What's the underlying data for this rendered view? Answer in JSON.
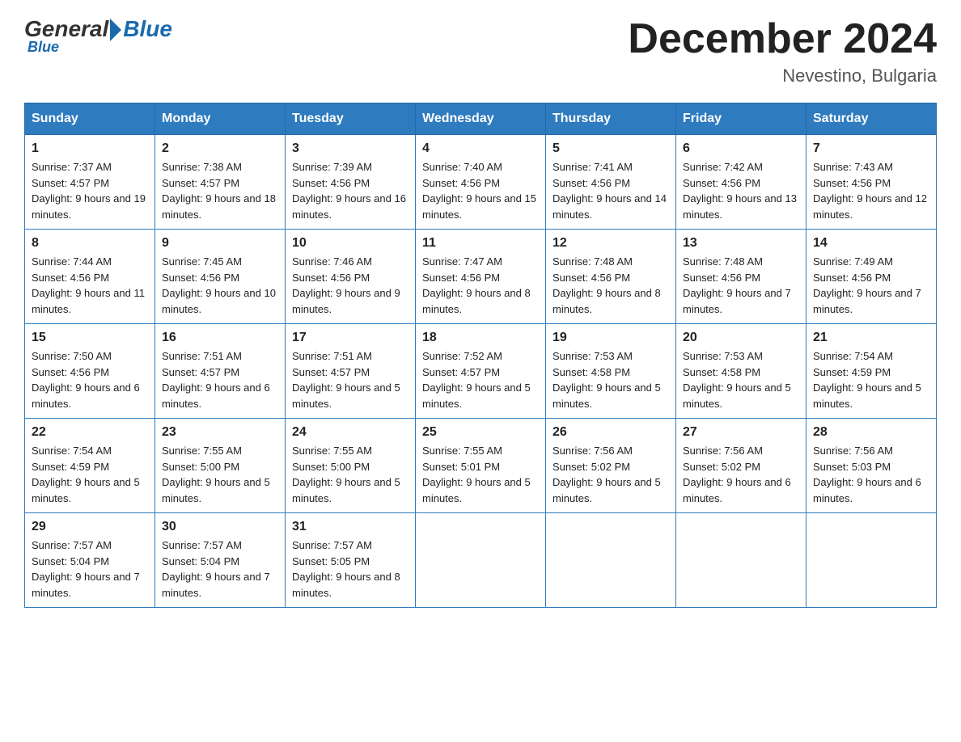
{
  "header": {
    "logo_general": "General",
    "logo_blue": "Blue",
    "title": "December 2024",
    "subtitle": "Nevestino, Bulgaria"
  },
  "weekdays": [
    "Sunday",
    "Monday",
    "Tuesday",
    "Wednesday",
    "Thursday",
    "Friday",
    "Saturday"
  ],
  "weeks": [
    [
      {
        "day": "1",
        "sunrise": "Sunrise: 7:37 AM",
        "sunset": "Sunset: 4:57 PM",
        "daylight": "Daylight: 9 hours and 19 minutes."
      },
      {
        "day": "2",
        "sunrise": "Sunrise: 7:38 AM",
        "sunset": "Sunset: 4:57 PM",
        "daylight": "Daylight: 9 hours and 18 minutes."
      },
      {
        "day": "3",
        "sunrise": "Sunrise: 7:39 AM",
        "sunset": "Sunset: 4:56 PM",
        "daylight": "Daylight: 9 hours and 16 minutes."
      },
      {
        "day": "4",
        "sunrise": "Sunrise: 7:40 AM",
        "sunset": "Sunset: 4:56 PM",
        "daylight": "Daylight: 9 hours and 15 minutes."
      },
      {
        "day": "5",
        "sunrise": "Sunrise: 7:41 AM",
        "sunset": "Sunset: 4:56 PM",
        "daylight": "Daylight: 9 hours and 14 minutes."
      },
      {
        "day": "6",
        "sunrise": "Sunrise: 7:42 AM",
        "sunset": "Sunset: 4:56 PM",
        "daylight": "Daylight: 9 hours and 13 minutes."
      },
      {
        "day": "7",
        "sunrise": "Sunrise: 7:43 AM",
        "sunset": "Sunset: 4:56 PM",
        "daylight": "Daylight: 9 hours and 12 minutes."
      }
    ],
    [
      {
        "day": "8",
        "sunrise": "Sunrise: 7:44 AM",
        "sunset": "Sunset: 4:56 PM",
        "daylight": "Daylight: 9 hours and 11 minutes."
      },
      {
        "day": "9",
        "sunrise": "Sunrise: 7:45 AM",
        "sunset": "Sunset: 4:56 PM",
        "daylight": "Daylight: 9 hours and 10 minutes."
      },
      {
        "day": "10",
        "sunrise": "Sunrise: 7:46 AM",
        "sunset": "Sunset: 4:56 PM",
        "daylight": "Daylight: 9 hours and 9 minutes."
      },
      {
        "day": "11",
        "sunrise": "Sunrise: 7:47 AM",
        "sunset": "Sunset: 4:56 PM",
        "daylight": "Daylight: 9 hours and 8 minutes."
      },
      {
        "day": "12",
        "sunrise": "Sunrise: 7:48 AM",
        "sunset": "Sunset: 4:56 PM",
        "daylight": "Daylight: 9 hours and 8 minutes."
      },
      {
        "day": "13",
        "sunrise": "Sunrise: 7:48 AM",
        "sunset": "Sunset: 4:56 PM",
        "daylight": "Daylight: 9 hours and 7 minutes."
      },
      {
        "day": "14",
        "sunrise": "Sunrise: 7:49 AM",
        "sunset": "Sunset: 4:56 PM",
        "daylight": "Daylight: 9 hours and 7 minutes."
      }
    ],
    [
      {
        "day": "15",
        "sunrise": "Sunrise: 7:50 AM",
        "sunset": "Sunset: 4:56 PM",
        "daylight": "Daylight: 9 hours and 6 minutes."
      },
      {
        "day": "16",
        "sunrise": "Sunrise: 7:51 AM",
        "sunset": "Sunset: 4:57 PM",
        "daylight": "Daylight: 9 hours and 6 minutes."
      },
      {
        "day": "17",
        "sunrise": "Sunrise: 7:51 AM",
        "sunset": "Sunset: 4:57 PM",
        "daylight": "Daylight: 9 hours and 5 minutes."
      },
      {
        "day": "18",
        "sunrise": "Sunrise: 7:52 AM",
        "sunset": "Sunset: 4:57 PM",
        "daylight": "Daylight: 9 hours and 5 minutes."
      },
      {
        "day": "19",
        "sunrise": "Sunrise: 7:53 AM",
        "sunset": "Sunset: 4:58 PM",
        "daylight": "Daylight: 9 hours and 5 minutes."
      },
      {
        "day": "20",
        "sunrise": "Sunrise: 7:53 AM",
        "sunset": "Sunset: 4:58 PM",
        "daylight": "Daylight: 9 hours and 5 minutes."
      },
      {
        "day": "21",
        "sunrise": "Sunrise: 7:54 AM",
        "sunset": "Sunset: 4:59 PM",
        "daylight": "Daylight: 9 hours and 5 minutes."
      }
    ],
    [
      {
        "day": "22",
        "sunrise": "Sunrise: 7:54 AM",
        "sunset": "Sunset: 4:59 PM",
        "daylight": "Daylight: 9 hours and 5 minutes."
      },
      {
        "day": "23",
        "sunrise": "Sunrise: 7:55 AM",
        "sunset": "Sunset: 5:00 PM",
        "daylight": "Daylight: 9 hours and 5 minutes."
      },
      {
        "day": "24",
        "sunrise": "Sunrise: 7:55 AM",
        "sunset": "Sunset: 5:00 PM",
        "daylight": "Daylight: 9 hours and 5 minutes."
      },
      {
        "day": "25",
        "sunrise": "Sunrise: 7:55 AM",
        "sunset": "Sunset: 5:01 PM",
        "daylight": "Daylight: 9 hours and 5 minutes."
      },
      {
        "day": "26",
        "sunrise": "Sunrise: 7:56 AM",
        "sunset": "Sunset: 5:02 PM",
        "daylight": "Daylight: 9 hours and 5 minutes."
      },
      {
        "day": "27",
        "sunrise": "Sunrise: 7:56 AM",
        "sunset": "Sunset: 5:02 PM",
        "daylight": "Daylight: 9 hours and 6 minutes."
      },
      {
        "day": "28",
        "sunrise": "Sunrise: 7:56 AM",
        "sunset": "Sunset: 5:03 PM",
        "daylight": "Daylight: 9 hours and 6 minutes."
      }
    ],
    [
      {
        "day": "29",
        "sunrise": "Sunrise: 7:57 AM",
        "sunset": "Sunset: 5:04 PM",
        "daylight": "Daylight: 9 hours and 7 minutes."
      },
      {
        "day": "30",
        "sunrise": "Sunrise: 7:57 AM",
        "sunset": "Sunset: 5:04 PM",
        "daylight": "Daylight: 9 hours and 7 minutes."
      },
      {
        "day": "31",
        "sunrise": "Sunrise: 7:57 AM",
        "sunset": "Sunset: 5:05 PM",
        "daylight": "Daylight: 9 hours and 8 minutes."
      },
      null,
      null,
      null,
      null
    ]
  ]
}
